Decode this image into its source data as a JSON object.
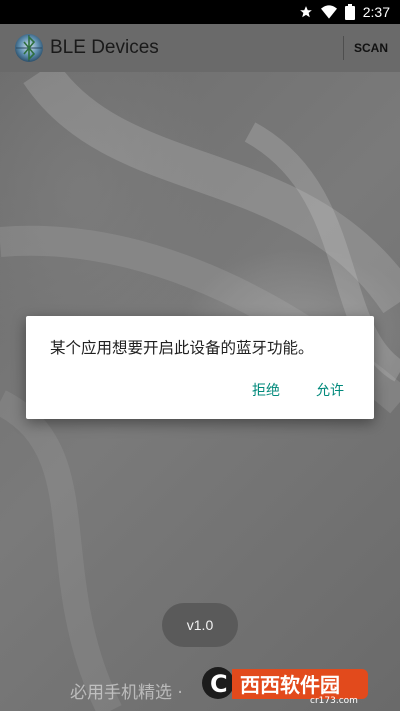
{
  "status_bar": {
    "time": "2:37",
    "icons": [
      "star-icon",
      "wifi-icon",
      "battery-icon"
    ]
  },
  "app_bar": {
    "title": "BLE Devices",
    "action": "SCAN",
    "logo_icon": "bluetooth-globe-icon"
  },
  "dialog": {
    "message": "某个应用想要开启此设备的蓝牙功能。",
    "deny_label": "拒绝",
    "allow_label": "允许",
    "accent_color": "#00897b"
  },
  "version_badge": "v1.0",
  "watermark": {
    "text": "必用手机精选 · ",
    "brand_name": "西西软件园",
    "brand_url": "cr173.com"
  }
}
